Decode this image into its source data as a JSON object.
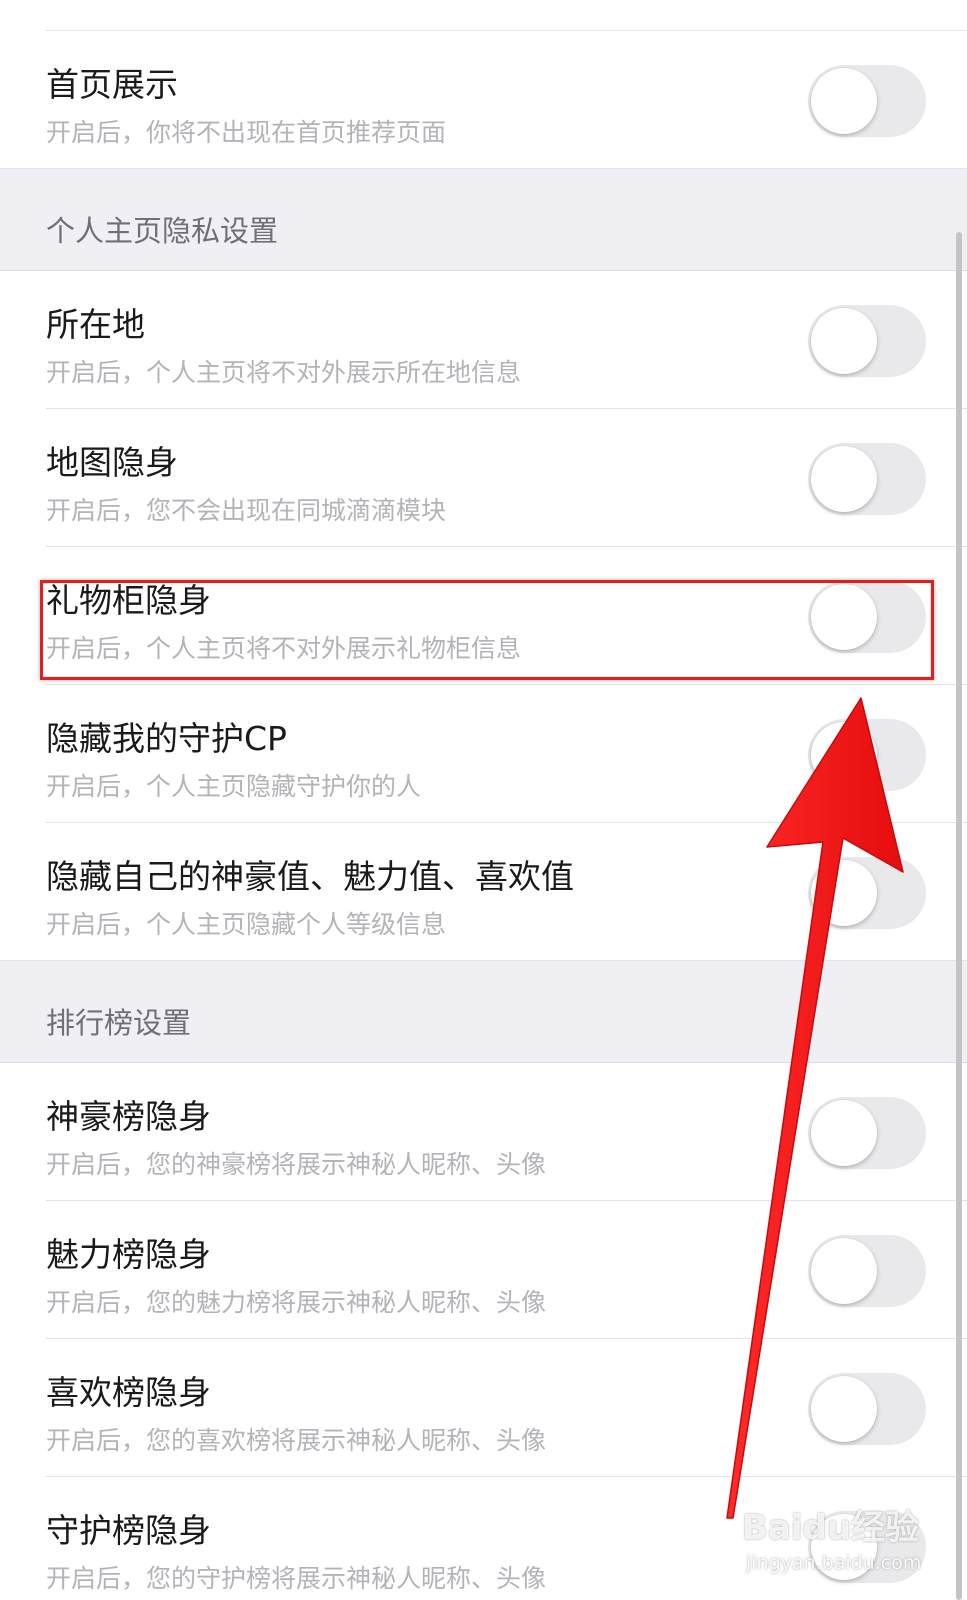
{
  "items_top": [
    {
      "title": "首页展示",
      "desc": "开启后，你将不出现在首页推荐页面",
      "enabled": false
    }
  ],
  "section_profile": {
    "label": "个人主页隐私设置",
    "items": [
      {
        "title": "所在地",
        "desc": "开启后，个人主页将不对外展示所在地信息",
        "enabled": false
      },
      {
        "title": "地图隐身",
        "desc": "开启后，您不会出现在同城滴滴模块",
        "enabled": false
      },
      {
        "title": "礼物柜隐身",
        "desc": "开启后，个人主页将不对外展示礼物柜信息",
        "enabled": false
      },
      {
        "title": "隐藏我的守护CP",
        "desc": "开启后，个人主页隐藏守护你的人",
        "enabled": false
      },
      {
        "title": "隐藏自己的神豪值、魅力值、喜欢值",
        "desc": "开启后，个人主页隐藏个人等级信息",
        "enabled": false
      }
    ]
  },
  "section_rank": {
    "label": "排行榜设置",
    "items": [
      {
        "title": "神豪榜隐身",
        "desc": "开启后，您的神豪榜将展示神秘人昵称、头像",
        "enabled": false
      },
      {
        "title": "魅力榜隐身",
        "desc": "开启后，您的魅力榜将展示神秘人昵称、头像",
        "enabled": false
      },
      {
        "title": "喜欢榜隐身",
        "desc": "开启后，您的喜欢榜将展示神秘人昵称、头像",
        "enabled": false
      },
      {
        "title": "守护榜隐身",
        "desc": "开启后，您的守护榜将展示神秘人昵称、头像",
        "enabled": false
      }
    ]
  },
  "annotation": {
    "highlight_color": "#e01f1f",
    "arrow_color": "#ff1a1a"
  },
  "watermark": {
    "text": "Baidu经验",
    "sub": "jingyan.baidu.com"
  },
  "colors": {
    "toggle_off": "#e9e9eb",
    "section_bg": "#efeff4",
    "title": "#1a1a1a",
    "desc": "#b3b3b8"
  }
}
